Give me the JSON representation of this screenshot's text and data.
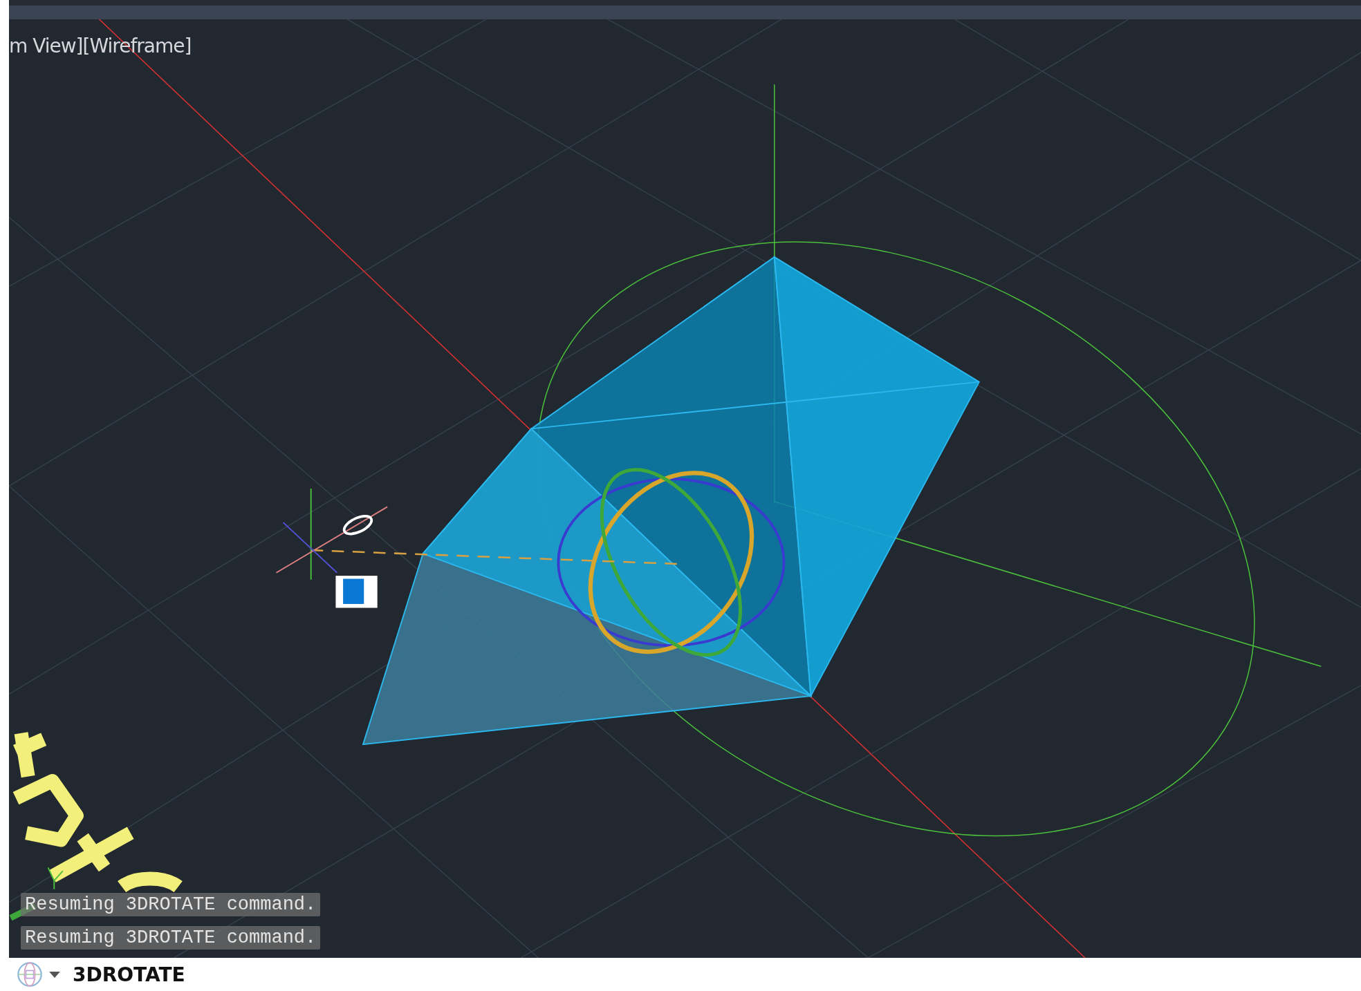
{
  "viewport": {
    "label": "m View][Wireframe]"
  },
  "command_history": [
    {
      "text": "Resuming 3DROTATE command."
    },
    {
      "text": "Resuming 3DROTATE command."
    }
  ],
  "command_line": {
    "value": "3DROTATE"
  }
}
